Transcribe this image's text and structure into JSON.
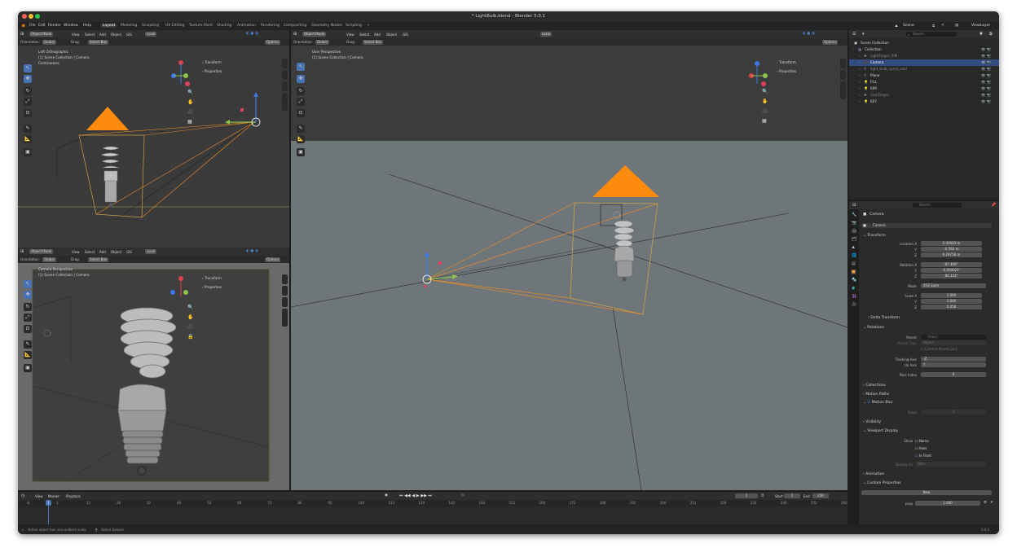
{
  "window": {
    "title": "* LightBulb.blend - Blender 5.0.1",
    "traffic": [
      "#ff5f57",
      "#febc2e",
      "#28c840"
    ]
  },
  "menu": [
    "File",
    "Edit",
    "Render",
    "Window",
    "Help"
  ],
  "workspaces": [
    "Layout",
    "Modeling",
    "Sculpting",
    "UV Editing",
    "Texture Paint",
    "Shading",
    "Animation",
    "Rendering",
    "Compositing",
    "Geometry Nodes",
    "Scripting"
  ],
  "topright": {
    "scene": "Scene",
    "viewlayer": "ViewLayer"
  },
  "viewport_header": {
    "mode": "Object Mode",
    "menus": [
      "View",
      "Select",
      "Add",
      "Object",
      "GIS"
    ],
    "transform": "Local",
    "options": "Options",
    "orientation_label": "Orientation:",
    "orientation_value": "Global",
    "drag_label": "Drag:",
    "drag_value": "Select Box"
  },
  "vp_topleft": {
    "view_name": "Left Orthographic",
    "collection": "(1) Scene Collection | Camera",
    "units": "Centimeters",
    "panel_transform": "Transform",
    "panel_properties": "Properties",
    "tabs": [
      "Item",
      "Tool",
      "View",
      "Animation"
    ]
  },
  "vp_bottomleft": {
    "view_name": "Camera Perspective",
    "collection": "(1) Scene Collection | Camera",
    "panel_transform": "Transform",
    "panel_properties": "Properties",
    "tabs": [
      "Item",
      "Tool",
      "View",
      "Animation"
    ]
  },
  "vp_main": {
    "view_name": "User Perspective",
    "collection": "(1) Scene Collection | Camera",
    "panel_transform": "Transform",
    "panel_properties": "Properties",
    "tabs": [
      "Item",
      "Tool",
      "View"
    ]
  },
  "outliner": {
    "search_placeholder": "Search",
    "root": "Scene Collection",
    "items": [
      {
        "name": "Collection",
        "indent": 1,
        "selected": false,
        "dim": false,
        "color": "#d8d8d8",
        "icon": "collection-icon"
      },
      {
        "name": "LightTarget_RIM",
        "indent": 2,
        "selected": false,
        "dim": true,
        "color": "#8a8a8a",
        "icon": "empty-icon"
      },
      {
        "name": "Camera",
        "indent": 2,
        "selected": true,
        "dim": false,
        "color": "#ffffff",
        "icon": "camera-icon"
      },
      {
        "name": "light_bulb_spiral_cool",
        "indent": 2,
        "selected": false,
        "dim": true,
        "color": "#8a8a8a",
        "icon": "mesh-icon"
      },
      {
        "name": "Plane",
        "indent": 2,
        "selected": false,
        "dim": false,
        "color": "#d8d8d8",
        "icon": "mesh-icon"
      },
      {
        "name": "FILL",
        "indent": 2,
        "selected": false,
        "dim": false,
        "color": "#d8d8d8",
        "icon": "light-icon"
      },
      {
        "name": "RIM",
        "indent": 2,
        "selected": false,
        "dim": false,
        "color": "#d8d8d8",
        "icon": "light-icon"
      },
      {
        "name": "CamTarget",
        "indent": 2,
        "selected": false,
        "dim": true,
        "color": "#8a8a8a",
        "icon": "empty-icon"
      },
      {
        "name": "KEY",
        "indent": 2,
        "selected": false,
        "dim": false,
        "color": "#d8d8d8",
        "icon": "light-icon"
      }
    ]
  },
  "properties": {
    "search_placeholder": "Search",
    "object_name": "Camera",
    "object_field": "Camera",
    "transform": {
      "header": "Transform",
      "location_label": "Location X",
      "location": [
        "0.44603 m",
        "-0.562 m",
        "0.29758 m"
      ],
      "rotation_label": "Rotation X",
      "rotation": [
        "87.499°",
        "-0.000021°",
        "84.333°"
      ],
      "mode_label": "Mode",
      "mode": "XYZ Euler",
      "scale_label": "Scale X",
      "scale": [
        "1.000",
        "1.000",
        "0.058"
      ],
      "axis_y": "Y",
      "axis_z": "Z"
    },
    "delta_transform": "Delta Transform",
    "relations": {
      "header": "Relations",
      "parent_label": "Parent",
      "parent_value": "Object",
      "parent_type_label": "Parent Type",
      "parent_type_value": "Object",
      "camera_parent_lock": "Camera Parent Lock",
      "tracking_label": "Tracking Axis",
      "tracking_value": "-Z",
      "up_label": "Up Axis",
      "up_value": "Y",
      "pass_label": "Pass Index",
      "pass_value": "0"
    },
    "collections": "Collections",
    "motion_paths": "Motion Paths",
    "motion_blur": "Motion Blur",
    "steps_label": "Steps",
    "steps_value": "1",
    "visibility": "Visibility",
    "viewport_display": {
      "header": "Viewport Display",
      "show_label": "Show",
      "name": "Name",
      "axes": "Axes",
      "in_front": "In Front",
      "display_as_label": "Display As",
      "display_as": "Wire"
    },
    "animation": "Animation",
    "custom_props": "Custom Properties",
    "new_button": "New",
    "prop_label": "prop",
    "prop_value": "1.000"
  },
  "timeline": {
    "menus": [
      "View",
      "Marker",
      "Playback"
    ],
    "current": "1",
    "start_label": "Start",
    "start": "1",
    "end_label": "End",
    "end": "250",
    "ticks": [
      "-8",
      "1",
      "12",
      "20",
      "32",
      "40",
      "52",
      "60",
      "72",
      "80",
      "92",
      "100",
      "112",
      "120",
      "132",
      "140",
      "152",
      "160",
      "172",
      "180",
      "192",
      "200",
      "212",
      "220",
      "232",
      "240",
      "252",
      "260"
    ]
  },
  "status": {
    "left": "Active object has non-uniform scale",
    "select": "Select Extend",
    "version": "5.0.1"
  }
}
